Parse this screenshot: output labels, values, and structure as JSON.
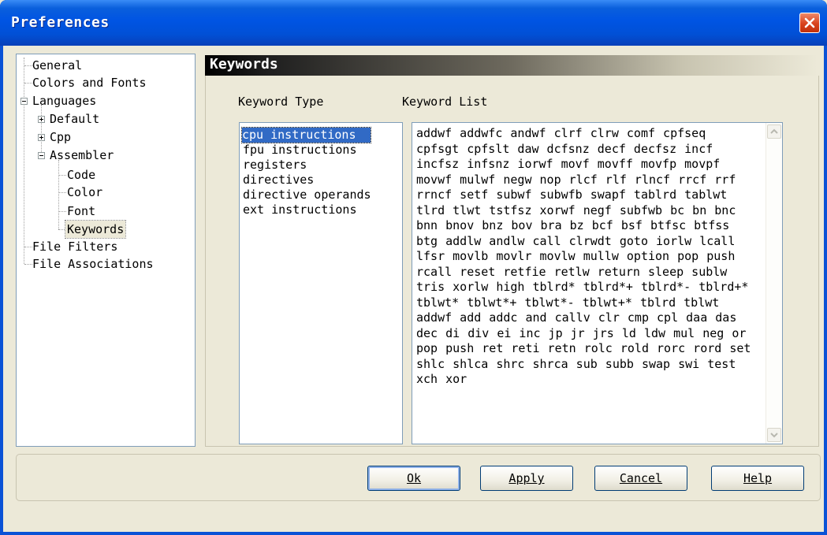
{
  "window": {
    "title": "Preferences"
  },
  "tree": {
    "items": [
      {
        "label": "General"
      },
      {
        "label": "Colors and Fonts"
      },
      {
        "label": "Languages"
      },
      {
        "label": "Default"
      },
      {
        "label": "Cpp"
      },
      {
        "label": "Assembler"
      },
      {
        "label": "Code"
      },
      {
        "label": "Color"
      },
      {
        "label": "Font"
      },
      {
        "label": "Keywords"
      },
      {
        "label": "File Filters"
      },
      {
        "label": "File Associations"
      }
    ],
    "selected": "Keywords"
  },
  "panel": {
    "header": "Keywords",
    "keyword_type_label": "Keyword Type",
    "keyword_list_label": "Keyword List",
    "types": [
      "cpu instructions",
      "fpu instructions",
      "registers",
      "directives",
      "directive operands",
      "ext instructions"
    ],
    "selected_type": "cpu instructions",
    "keyword_list": "addwf addwfc andwf clrf clrw comf cpfseq cpfsgt cpfslt daw dcfsnz decf decfsz incf incfsz infsnz iorwf movf movff movfp movpf movwf mulwf negw nop rlcf rlf rlncf rrcf rrf rrncf setf subwf subwfb swapf tablrd tablwt tlrd tlwt tstfsz xorwf negf subfwb bc bn bnc bnn bnov bnz bov bra bz bcf bsf btfsc btfss btg addlw andlw call clrwdt goto iorlw lcall lfsr movlb movlr movlw mullw option pop push rcall reset retfie retlw return sleep sublw tris xorlw high tblrd* tblrd*+ tblrd*- tblrd+* tblwt* tblwt*+ tblwt*- tblwt+* tblrd tblwt addwf add addc and callv clr cmp cpl daa das dec di div ei inc jp jr jrs ld ldw mul neg or pop push ret reti retn rolc rold rorc rord set shlc shlca shrc shrca sub subb swap swi test xch xor"
  },
  "buttons": {
    "ok": "Ok",
    "apply": "Apply",
    "cancel": "Cancel",
    "help": "Help"
  }
}
